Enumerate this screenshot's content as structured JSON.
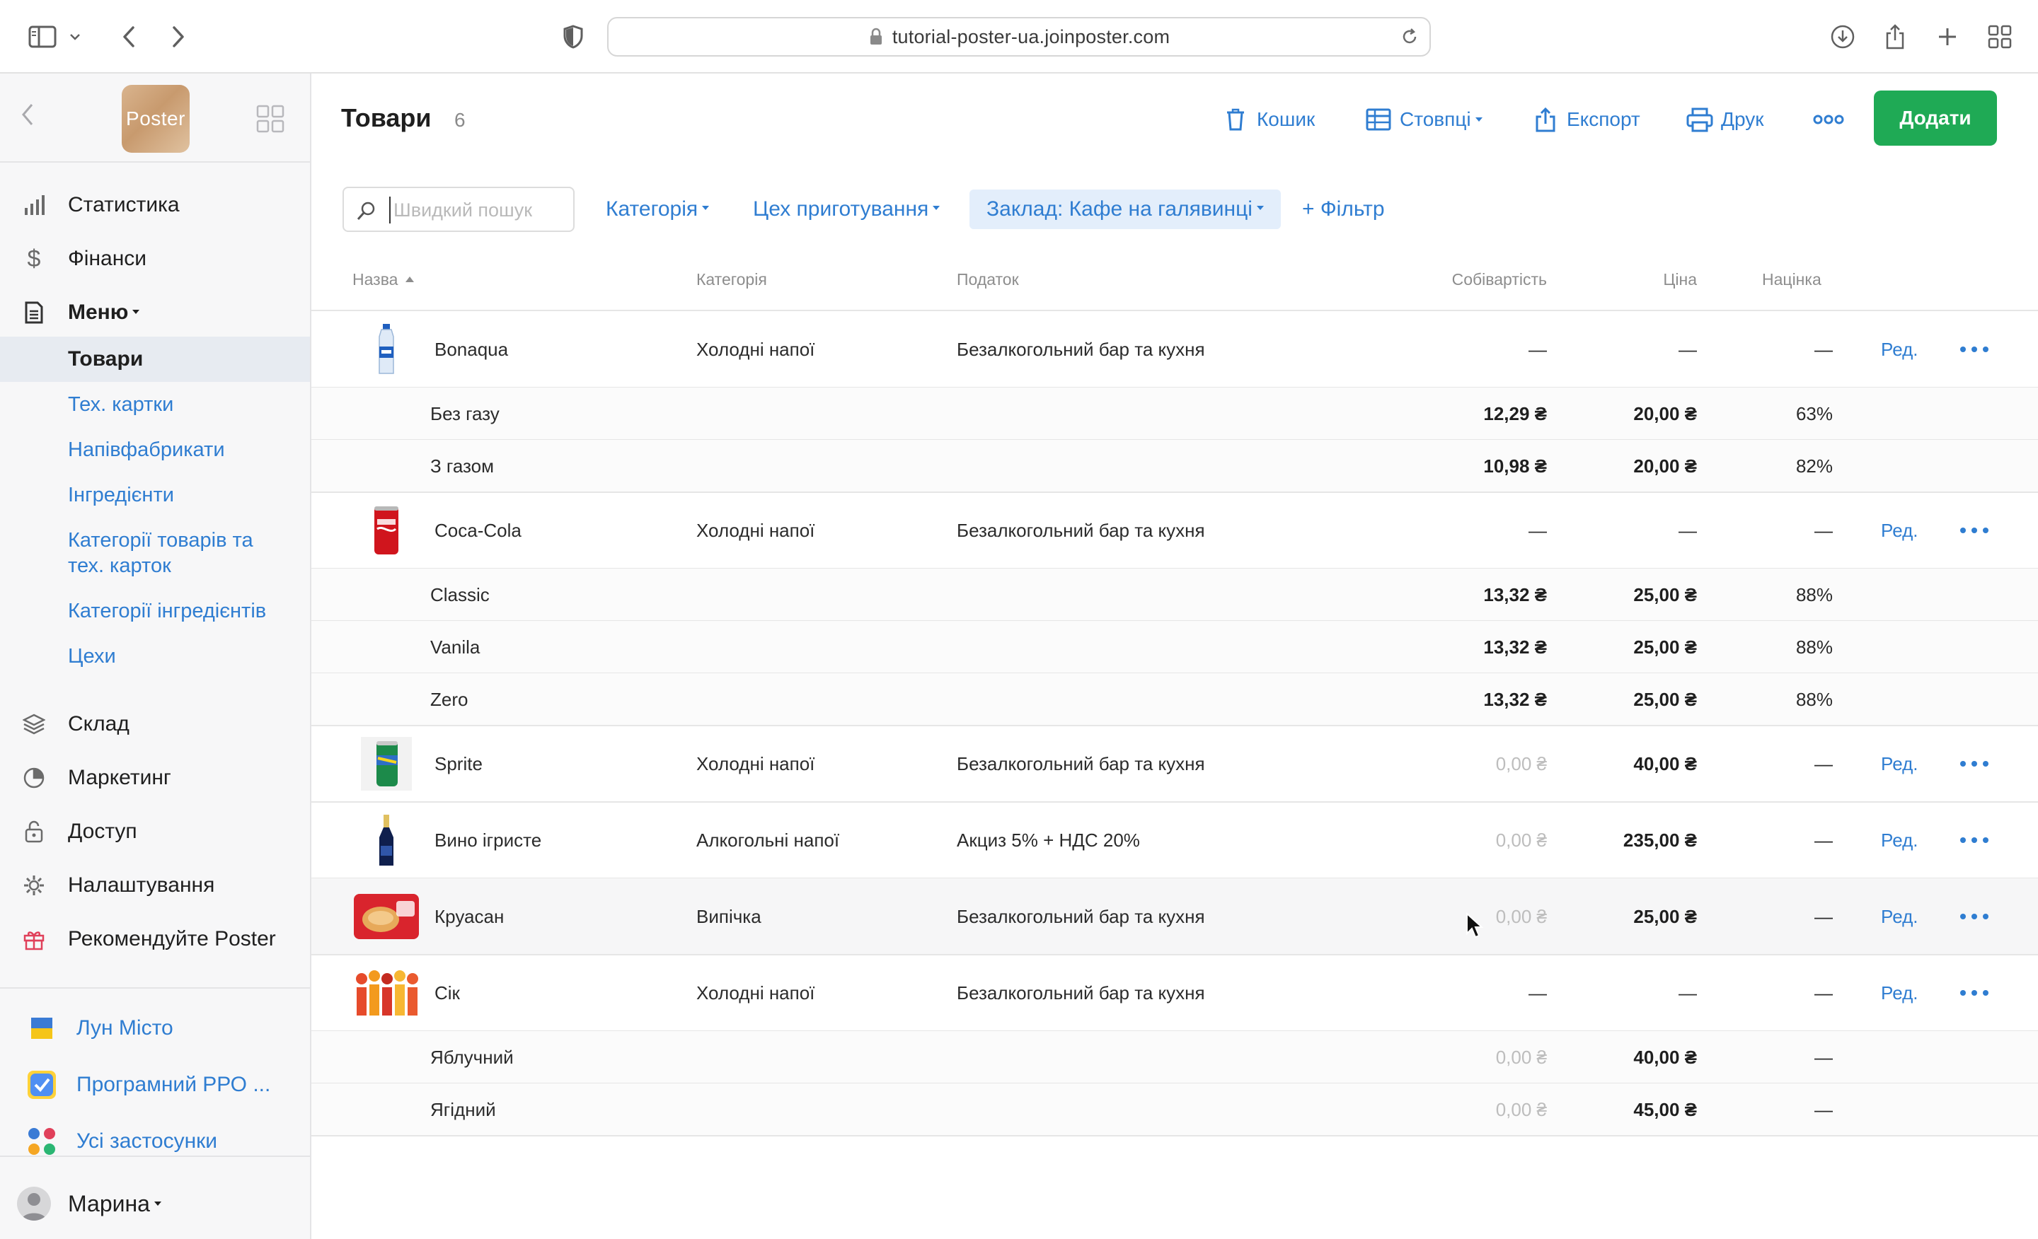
{
  "browser": {
    "url": "tutorial-poster-ua.joinposter.com"
  },
  "sidebar": {
    "logo_text": "Poster",
    "nav": [
      {
        "label": "Статистика",
        "icon": "bar-chart-icon"
      },
      {
        "label": "Фінанси",
        "icon": "dollar-icon"
      },
      {
        "label": "Меню",
        "icon": "document-icon"
      },
      {
        "label": "Склад",
        "icon": "layers-icon"
      },
      {
        "label": "Маркетинг",
        "icon": "pie-chart-icon"
      },
      {
        "label": "Доступ",
        "icon": "lock-icon"
      },
      {
        "label": "Налаштування",
        "icon": "gear-icon"
      },
      {
        "label": "Рекомендуйте Poster",
        "icon": "gift-icon"
      }
    ],
    "menu_sub": {
      "active": "Товари",
      "items": [
        "Тех. картки",
        "Напівфабрикати",
        "Інгредієнти",
        "Категорії товарів та",
        "тех. карток",
        "Категорії інгредієнтів",
        "Цехи"
      ]
    },
    "apps": [
      {
        "label": "Лун Місто",
        "icon": "ukraine-flag-icon"
      },
      {
        "label": "Програмний РРО ...",
        "icon": "checkbox-app-icon"
      },
      {
        "label": "Усі застосунки",
        "icon": "apps-dots-icon"
      }
    ],
    "user": "Марина"
  },
  "header": {
    "title": "Товари",
    "count": "6",
    "trash": "Кошик",
    "columns": "Стовпці",
    "export": "Експорт",
    "print": "Друк",
    "add": "Додати"
  },
  "filters": {
    "search_placeholder": "Швидкий пошук",
    "category": "Категорія",
    "workshop": "Цех приготування",
    "venue": "Заклад: Кафе на галявинці",
    "add_filter": "+ Фільтр"
  },
  "table": {
    "headers": {
      "name": "Назва",
      "category": "Категорія",
      "tax": "Податок",
      "cost": "Собівартість",
      "price": "Ціна",
      "markup": "Націнка"
    },
    "edit_label": "Ред.",
    "rows": [
      {
        "name": "Bonaqua",
        "category": "Холодні напої",
        "tax": "Безалкогольний бар та кухня",
        "cost": "—",
        "price": "—",
        "markup": "—",
        "image": "water-bottle"
      },
      {
        "name": "Без газу",
        "cost": "12,29 ₴",
        "price": "20,00 ₴",
        "markup": "63%"
      },
      {
        "name": "З газом",
        "cost": "10,98 ₴",
        "price": "20,00 ₴",
        "markup": "82%"
      },
      {
        "name": "Coca-Cola",
        "category": "Холодні напої",
        "tax": "Безалкогольний бар та кухня",
        "cost": "—",
        "price": "—",
        "markup": "—",
        "image": "cola-can"
      },
      {
        "name": "Classic",
        "cost": "13,32 ₴",
        "price": "25,00 ₴",
        "markup": "88%"
      },
      {
        "name": "Vanila",
        "cost": "13,32 ₴",
        "price": "25,00 ₴",
        "markup": "88%"
      },
      {
        "name": "Zero",
        "cost": "13,32 ₴",
        "price": "25,00 ₴",
        "markup": "88%"
      },
      {
        "name": "Sprite",
        "category": "Холодні напої",
        "tax": "Безалкогольний бар та кухня",
        "cost": "0,00 ₴",
        "price": "40,00 ₴",
        "markup": "—",
        "image": "sprite-can"
      },
      {
        "name": "Вино ігристе",
        "category": "Алкогольні напої",
        "tax": "Акциз 5% + НДС 20%",
        "cost": "0,00 ₴",
        "price": "235,00 ₴",
        "markup": "—",
        "image": "wine-bottle"
      },
      {
        "name": "Круасан",
        "category": "Випічка",
        "tax": "Безалкогольний бар та кухня",
        "cost": "0,00 ₴",
        "price": "25,00 ₴",
        "markup": "—",
        "image": "croissant-pack"
      },
      {
        "name": "Сік",
        "category": "Холодні напої",
        "tax": "Безалкогольний бар та кухня",
        "cost": "—",
        "price": "—",
        "markup": "—",
        "image": "juice-glasses"
      },
      {
        "name": "Яблучний",
        "cost": "0,00 ₴",
        "price": "40,00 ₴",
        "markup": "—"
      },
      {
        "name": "Ягідний",
        "cost": "0,00 ₴",
        "price": "45,00 ₴",
        "markup": "—"
      }
    ]
  },
  "colors": {
    "accent": "#2f7dd1",
    "add_button": "#1faa55",
    "sidebar_bg": "#f7f7f8",
    "active_item_bg": "#e7ebf1"
  }
}
